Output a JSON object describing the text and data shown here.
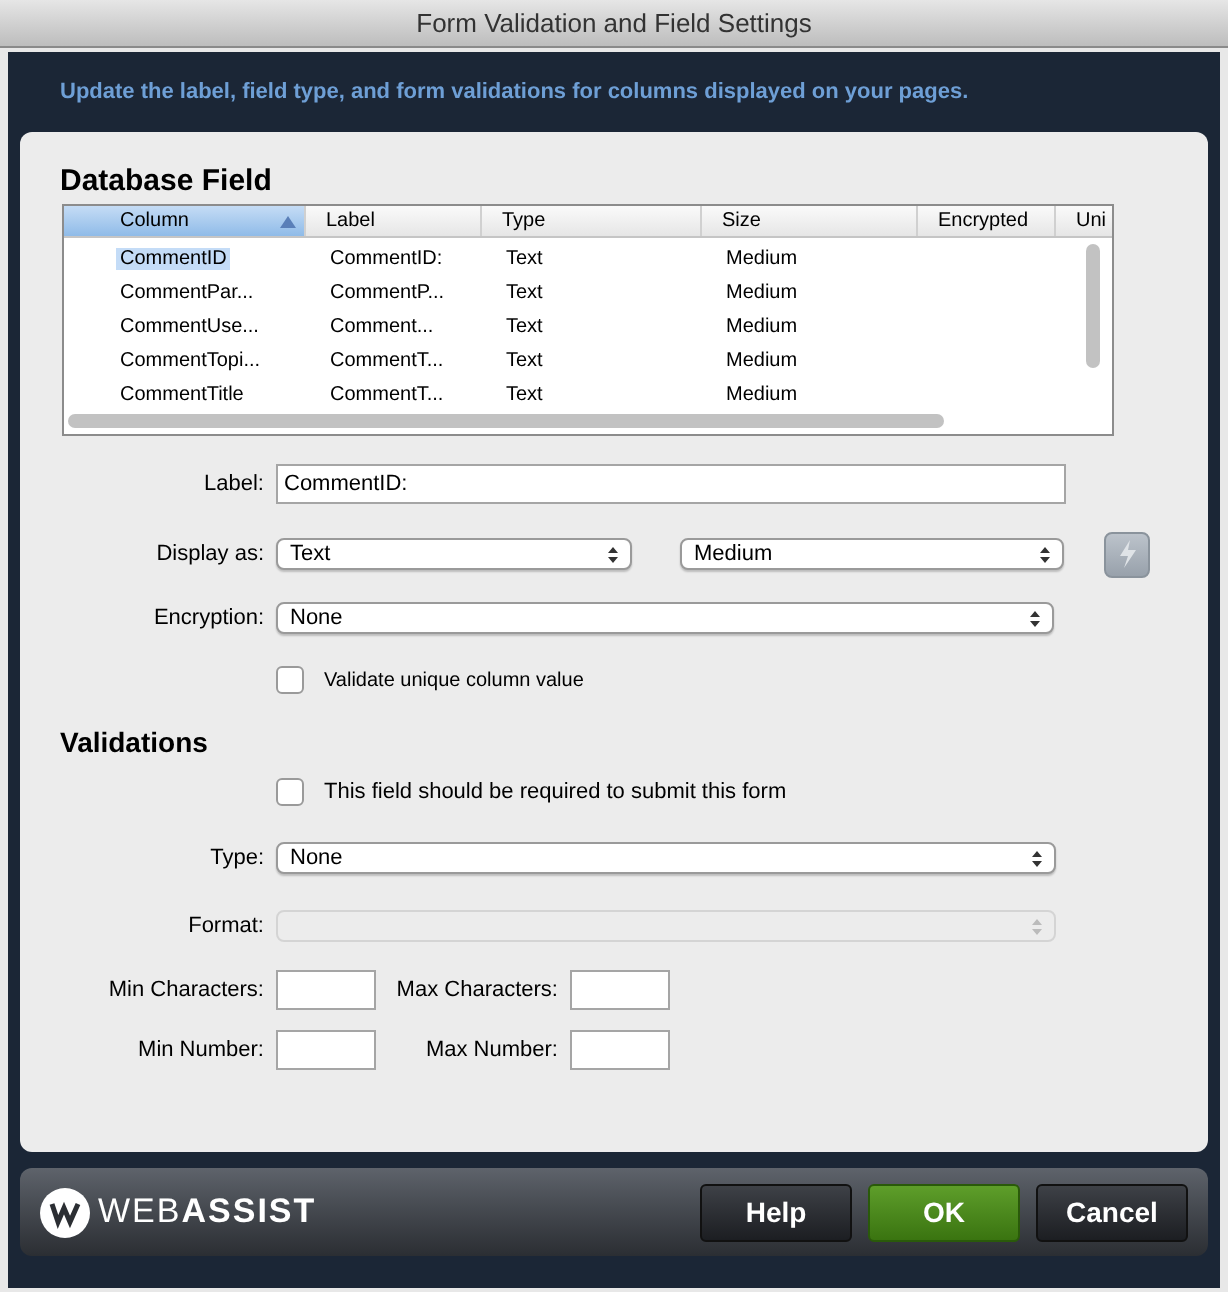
{
  "window": {
    "title": "Form Validation and Field Settings"
  },
  "banner": "Update the label, field type, and form validations for columns displayed on your pages.",
  "database_field": {
    "heading": "Database Field",
    "table": {
      "columns": [
        {
          "label": "Column",
          "sorted": true
        },
        {
          "label": "Label",
          "sorted": false
        },
        {
          "label": "Type",
          "sorted": false
        },
        {
          "label": "Size",
          "sorted": false
        },
        {
          "label": "Encrypted",
          "sorted": false
        },
        {
          "label": "Uni",
          "sorted": false
        }
      ],
      "rows": [
        {
          "cells": [
            "CommentID",
            "CommentID:",
            "Text",
            "Medium"
          ],
          "selected": true
        },
        {
          "cells": [
            "CommentPar...",
            "CommentP...",
            "Text",
            "Medium"
          ],
          "selected": false
        },
        {
          "cells": [
            "CommentUse...",
            "Comment...",
            "Text",
            "Medium"
          ],
          "selected": false
        },
        {
          "cells": [
            "CommentTopi...",
            "CommentT...",
            "Text",
            "Medium"
          ],
          "selected": false
        },
        {
          "cells": [
            "CommentTitle",
            "CommentT...",
            "Text",
            "Medium"
          ],
          "selected": false
        }
      ]
    },
    "label": {
      "label": "Label:",
      "value": "CommentID:"
    },
    "display_as": {
      "label": "Display as:",
      "type": "Text",
      "size": "Medium"
    },
    "encryption": {
      "label": "Encryption:",
      "value": "None"
    },
    "unique": {
      "label": "Validate unique column value",
      "checked": false
    }
  },
  "validations": {
    "heading": "Validations",
    "required": {
      "label": "This field should be required to submit this form",
      "checked": false
    },
    "type": {
      "label": "Type:",
      "value": "None",
      "disabled": false
    },
    "format": {
      "label": "Format:",
      "disabled": true
    },
    "min_characters": "Min Characters:",
    "max_characters": "Max Characters:",
    "min_number": "Min Number:",
    "max_number": "Max Number:"
  },
  "footer": {
    "brand": "WEB**ASSIST**",
    "buttons": [
      {
        "label": "Help",
        "kind": "normal"
      },
      {
        "label": "OK",
        "kind": "primary"
      },
      {
        "label": "Cancel",
        "kind": "normal"
      }
    ]
  }
}
